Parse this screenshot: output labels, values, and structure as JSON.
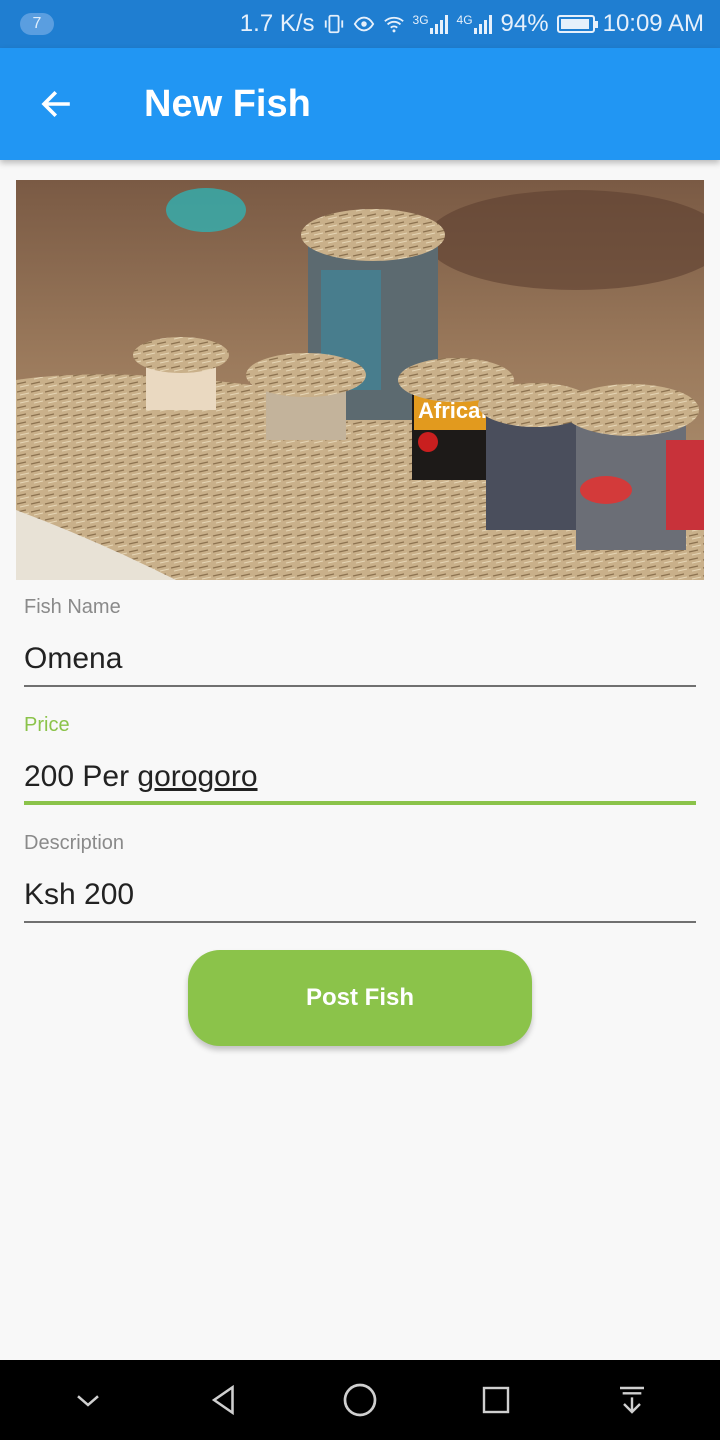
{
  "status_bar": {
    "notification_count": "7",
    "network_speed": "1.7 K/s",
    "signal_3g": "3G",
    "signal_4g": "4G",
    "battery": "94%",
    "battery_level": 0.94,
    "time": "10:09 AM"
  },
  "app_bar": {
    "title": "New Fish",
    "back_icon": "arrow-back-icon"
  },
  "hero_image": {
    "subject": "dried omena fish in tins at a market",
    "tin_label": "Africafe"
  },
  "form": {
    "fish_name": {
      "label": "Fish Name",
      "value": "Omena"
    },
    "price": {
      "label": "Price",
      "value_prefix": "200 Per ",
      "value_underlined": "gorogoro"
    },
    "description": {
      "label": "Description",
      "value": "Ksh 200"
    }
  },
  "post_button": {
    "label": "Post Fish"
  },
  "nav_bar": {
    "icons": [
      "chevron-down-icon",
      "back-triangle-icon",
      "home-circle-icon",
      "recents-square-icon",
      "download-icon"
    ]
  },
  "colors": {
    "status_bar": "#1f7ed1",
    "app_bar": "#2196f3",
    "accent": "#8bc34a",
    "background": "#f8f8f8"
  }
}
